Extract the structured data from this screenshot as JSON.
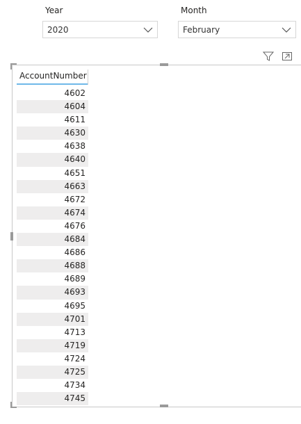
{
  "slicers": {
    "year": {
      "label": "Year",
      "value": "2020"
    },
    "month": {
      "label": "Month",
      "value": "February"
    }
  },
  "header_icons": [
    "filter-icon",
    "focus-mode-icon"
  ],
  "table": {
    "column_header": "AccountNumber",
    "rows": [
      "4602",
      "4604",
      "4611",
      "4630",
      "4638",
      "4640",
      "4651",
      "4663",
      "4672",
      "4674",
      "4676",
      "4684",
      "4686",
      "4688",
      "4689",
      "4693",
      "4695",
      "4701",
      "4713",
      "4719",
      "4724",
      "4725",
      "4734",
      "4745"
    ]
  },
  "colors": {
    "header_underline": "#6fb8e9",
    "alt_row": "#eeeded",
    "border": "#c8c8c8"
  }
}
